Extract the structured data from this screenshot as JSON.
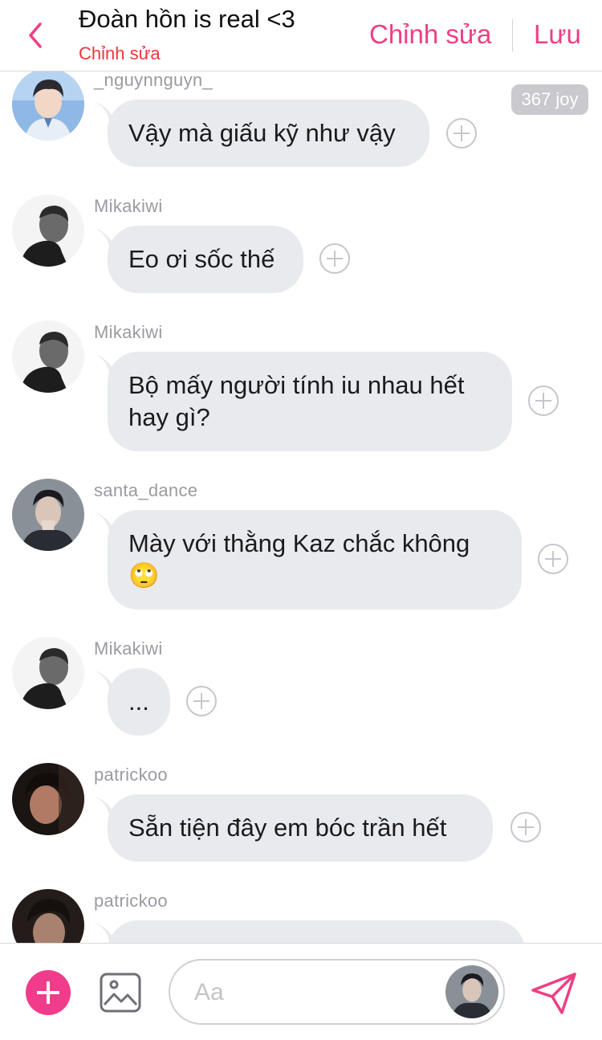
{
  "header": {
    "title": "Đoàn hồn is real <3",
    "subtitle": "Chỉnh sửa",
    "edit_label": "Chỉnh sửa",
    "save_label": "Lưu"
  },
  "joy_badge": "367 joy",
  "messages": [
    {
      "username": "_nguynnguyn_",
      "text": "Vậy mà giấu kỹ như vậy"
    },
    {
      "username": "Mikakiwi",
      "text": "Eo ơi sốc thế"
    },
    {
      "username": "Mikakiwi",
      "text": "Bộ mấy người tính iu nhau hết hay gì?"
    },
    {
      "username": "santa_dance",
      "text": "Mày với thằng Kaz chắc không 🙄"
    },
    {
      "username": "Mikakiwi",
      "text": "..."
    },
    {
      "username": "patrickoo",
      "text": "Sẵn tiện đây em bóc trần hết"
    },
    {
      "username": "patrickoo",
      "text": ""
    }
  ],
  "composer": {
    "placeholder": "Aa"
  },
  "colors": {
    "accent": "#ee3e84",
    "subtitle": "#f0353a",
    "bubble": "#e9eaee"
  }
}
